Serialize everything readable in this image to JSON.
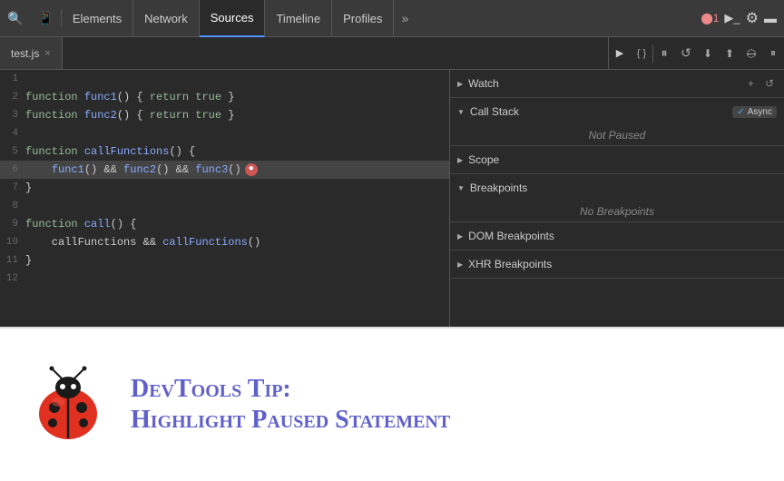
{
  "toolbar": {
    "tabs": [
      {
        "id": "elements",
        "label": "Elements",
        "active": false
      },
      {
        "id": "network",
        "label": "Network",
        "active": false
      },
      {
        "id": "sources",
        "label": "Sources",
        "active": true
      },
      {
        "id": "timeline",
        "label": "Timeline",
        "active": false
      },
      {
        "id": "profiles",
        "label": "Profiles",
        "active": false
      }
    ],
    "more_label": "»",
    "badge_label": "⬤1",
    "terminal_label": "▶_",
    "settings_label": "⚙",
    "dock_label": "▬"
  },
  "debug_controls": [
    {
      "id": "pause",
      "icon": "⏸",
      "title": "Pause"
    },
    {
      "id": "step-over",
      "icon": "↺",
      "title": "Step over"
    },
    {
      "id": "step-into",
      "icon": "↓",
      "title": "Step into"
    },
    {
      "id": "step-out",
      "icon": "↑",
      "title": "Step out"
    },
    {
      "id": "deactivate",
      "icon": "⟿",
      "title": "Deactivate breakpoints"
    },
    {
      "id": "pause-exceptions",
      "icon": "⏸",
      "title": "Pause on exceptions"
    }
  ],
  "file_tab": {
    "name": "test.js",
    "close": "×"
  },
  "code_lines": [
    {
      "num": "1",
      "code": "",
      "style": "normal"
    },
    {
      "num": "2",
      "code": "function func1() { return true }",
      "style": "normal"
    },
    {
      "num": "3",
      "code": "function func2() { return true }",
      "style": "normal"
    },
    {
      "num": "4",
      "code": "",
      "style": "normal"
    },
    {
      "num": "5",
      "code": "function callFunctions() {",
      "style": "normal"
    },
    {
      "num": "6",
      "code": "    func1() && func2() && func3()",
      "style": "highlighted",
      "has_error": true
    },
    {
      "num": "7",
      "code": "}",
      "style": "normal"
    },
    {
      "num": "8",
      "code": "",
      "style": "normal"
    },
    {
      "num": "9",
      "code": "function call() {",
      "style": "normal"
    },
    {
      "num": "10",
      "code": "    callFunctions && callFunctions()",
      "style": "normal"
    },
    {
      "num": "11",
      "code": "}",
      "style": "normal"
    },
    {
      "num": "12",
      "code": "",
      "style": "normal"
    }
  ],
  "right_panel": {
    "sections": [
      {
        "id": "watch",
        "label": "Watch",
        "expanded": false,
        "actions": [
          "+",
          "↺"
        ],
        "body": null,
        "async": false
      },
      {
        "id": "call-stack",
        "label": "Call Stack",
        "expanded": true,
        "actions": [],
        "body": "Not Paused",
        "async": true,
        "async_label": "✓ Async"
      },
      {
        "id": "scope",
        "label": "Scope",
        "expanded": false,
        "actions": [],
        "body": null,
        "async": false
      },
      {
        "id": "breakpoints",
        "label": "Breakpoints",
        "expanded": true,
        "actions": [],
        "body": "No Breakpoints",
        "async": false
      },
      {
        "id": "dom-breakpoints",
        "label": "DOM Breakpoints",
        "expanded": false,
        "actions": [],
        "body": null,
        "async": false
      },
      {
        "id": "xhr-breakpoints",
        "label": "XHR Breakpoints",
        "expanded": false,
        "actions": [],
        "body": null,
        "async": false
      }
    ]
  },
  "tip": {
    "label": "DevTools Tip:",
    "title": "Highlight Paused Statement"
  }
}
